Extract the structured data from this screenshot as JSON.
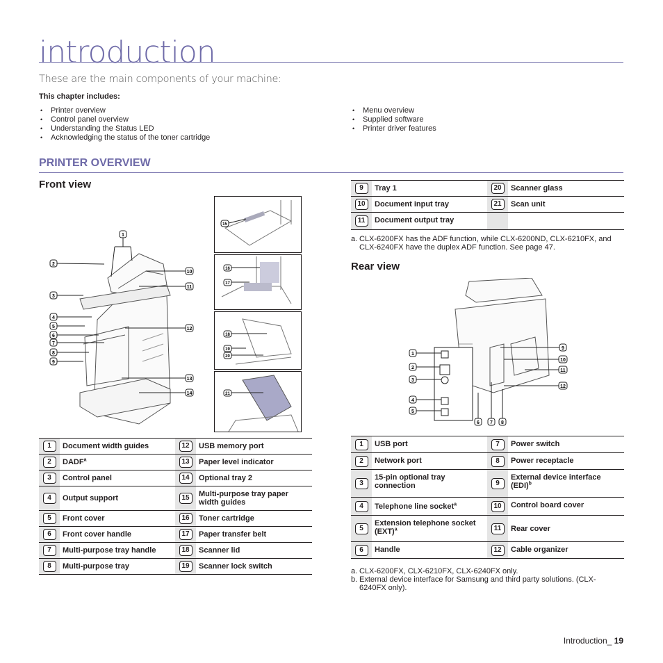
{
  "header": {
    "title": "introduction",
    "subtitle": "These are the main components of your machine:",
    "chapter_label": "This chapter includes:"
  },
  "chapter_items_left": [
    "Printer overview",
    "Control panel overview",
    "Understanding the Status LED",
    "Acknowledging the status of the toner cartridge"
  ],
  "chapter_items_right": [
    "Menu overview",
    "Supplied software",
    "Printer driver features"
  ],
  "section": {
    "title": "PRINTER OVERVIEW"
  },
  "front_view": {
    "heading": "Front view",
    "figure_callouts": [
      "1",
      "2",
      "3",
      "4",
      "5",
      "6",
      "7",
      "8",
      "9",
      "10",
      "11",
      "12",
      "13",
      "14"
    ],
    "detail_callouts": [
      [
        "15"
      ],
      [
        "16",
        "17"
      ],
      [
        "18",
        "19",
        "20"
      ],
      [
        "21"
      ]
    ],
    "rows": [
      [
        {
          "n": "1",
          "label": "Document width guides"
        },
        {
          "n": "12",
          "label": "USB memory port"
        }
      ],
      [
        {
          "n": "2",
          "label": "DADF",
          "sup": "a"
        },
        {
          "n": "13",
          "label": "Paper level indicator"
        }
      ],
      [
        {
          "n": "3",
          "label": "Control panel"
        },
        {
          "n": "14",
          "label": "Optional tray 2"
        }
      ],
      [
        {
          "n": "4",
          "label": "Output support"
        },
        {
          "n": "15",
          "label": "Multi-purpose tray paper width guides"
        }
      ],
      [
        {
          "n": "5",
          "label": "Front cover"
        },
        {
          "n": "16",
          "label": "Toner cartridge"
        }
      ],
      [
        {
          "n": "6",
          "label": "Front cover handle"
        },
        {
          "n": "17",
          "label": "Paper transfer belt"
        }
      ],
      [
        {
          "n": "7",
          "label": "Multi-purpose tray handle"
        },
        {
          "n": "18",
          "label": "Scanner lid"
        }
      ],
      [
        {
          "n": "8",
          "label": "Multi-purpose tray"
        },
        {
          "n": "19",
          "label": "Scanner lock switch"
        }
      ]
    ],
    "rows_continued": [
      [
        {
          "n": "9",
          "label": "Tray 1"
        },
        {
          "n": "20",
          "label": "Scanner glass"
        }
      ],
      [
        {
          "n": "10",
          "label": "Document input tray"
        },
        {
          "n": "21",
          "label": "Scan unit"
        }
      ],
      [
        {
          "n": "11",
          "label": "Document output tray"
        },
        {
          "n": "",
          "label": ""
        }
      ]
    ],
    "notes": [
      {
        "key": "a.",
        "text": "CLX-6200FX has the ADF function, while CLX-6200ND, CLX-6210FX, and CLX-6240FX have the duplex ADF function. See page 47."
      }
    ]
  },
  "rear_view": {
    "heading": "Rear view",
    "figure_callouts": [
      "1",
      "2",
      "3",
      "4",
      "5",
      "6",
      "7",
      "8",
      "9",
      "10",
      "11",
      "12"
    ],
    "rows": [
      [
        {
          "n": "1",
          "label": "USB port"
        },
        {
          "n": "7",
          "label": "Power switch"
        }
      ],
      [
        {
          "n": "2",
          "label": "Network port"
        },
        {
          "n": "8",
          "label": "Power receptacle"
        }
      ],
      [
        {
          "n": "3",
          "label": "15-pin optional tray connection"
        },
        {
          "n": "9",
          "label": "External device interface (EDI)",
          "sup": "b"
        }
      ],
      [
        {
          "n": "4",
          "label": "Telephone line socket",
          "sup": "a"
        },
        {
          "n": "10",
          "label": "Control board cover"
        }
      ],
      [
        {
          "n": "5",
          "label": "Extension telephone socket (EXT)",
          "sup": "a"
        },
        {
          "n": "11",
          "label": "Rear cover"
        }
      ],
      [
        {
          "n": "6",
          "label": "Handle"
        },
        {
          "n": "12",
          "label": "Cable organizer"
        }
      ]
    ],
    "notes": [
      {
        "key": "a.",
        "text": "CLX-6200FX, CLX-6210FX, CLX-6240FX only."
      },
      {
        "key": "b.",
        "text": "External device interface for Samsung and third party solutions. (CLX-6240FX only)."
      }
    ]
  },
  "footer": {
    "label": "Introduction_",
    "page": "19"
  },
  "colors": {
    "accent": "#6e6aa8",
    "text": "#231f20",
    "num_cell": "#e5e5e5"
  }
}
